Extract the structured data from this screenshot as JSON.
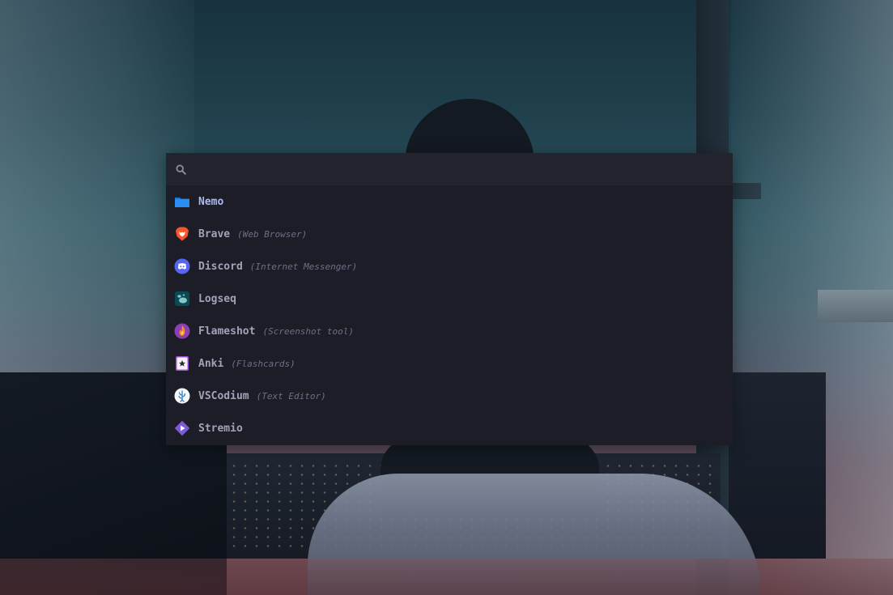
{
  "search": {
    "value": "",
    "placeholder": ""
  },
  "apps": [
    {
      "name": "Nemo",
      "description": "",
      "icon": "folder-icon"
    },
    {
      "name": "Brave",
      "description": "(Web Browser)",
      "icon": "brave-lion-icon"
    },
    {
      "name": "Discord",
      "description": "(Internet Messenger)",
      "icon": "discord-icon"
    },
    {
      "name": "Logseq",
      "description": "",
      "icon": "logseq-icon"
    },
    {
      "name": "Flameshot",
      "description": "(Screenshot tool)",
      "icon": "flameshot-icon"
    },
    {
      "name": "Anki",
      "description": "(Flashcards)",
      "icon": "anki-card-icon"
    },
    {
      "name": "VSCodium",
      "description": "(Text Editor)",
      "icon": "vscodium-icon"
    },
    {
      "name": "Stremio",
      "description": "",
      "icon": "stremio-icon"
    }
  ],
  "selected_index": 0,
  "colors": {
    "launcher_bg": "#1d1d28",
    "search_bg": "#24242f",
    "selected_text": "#aeb9ee",
    "item_text": "#a0a4b8",
    "description_text": "#6c7086"
  }
}
